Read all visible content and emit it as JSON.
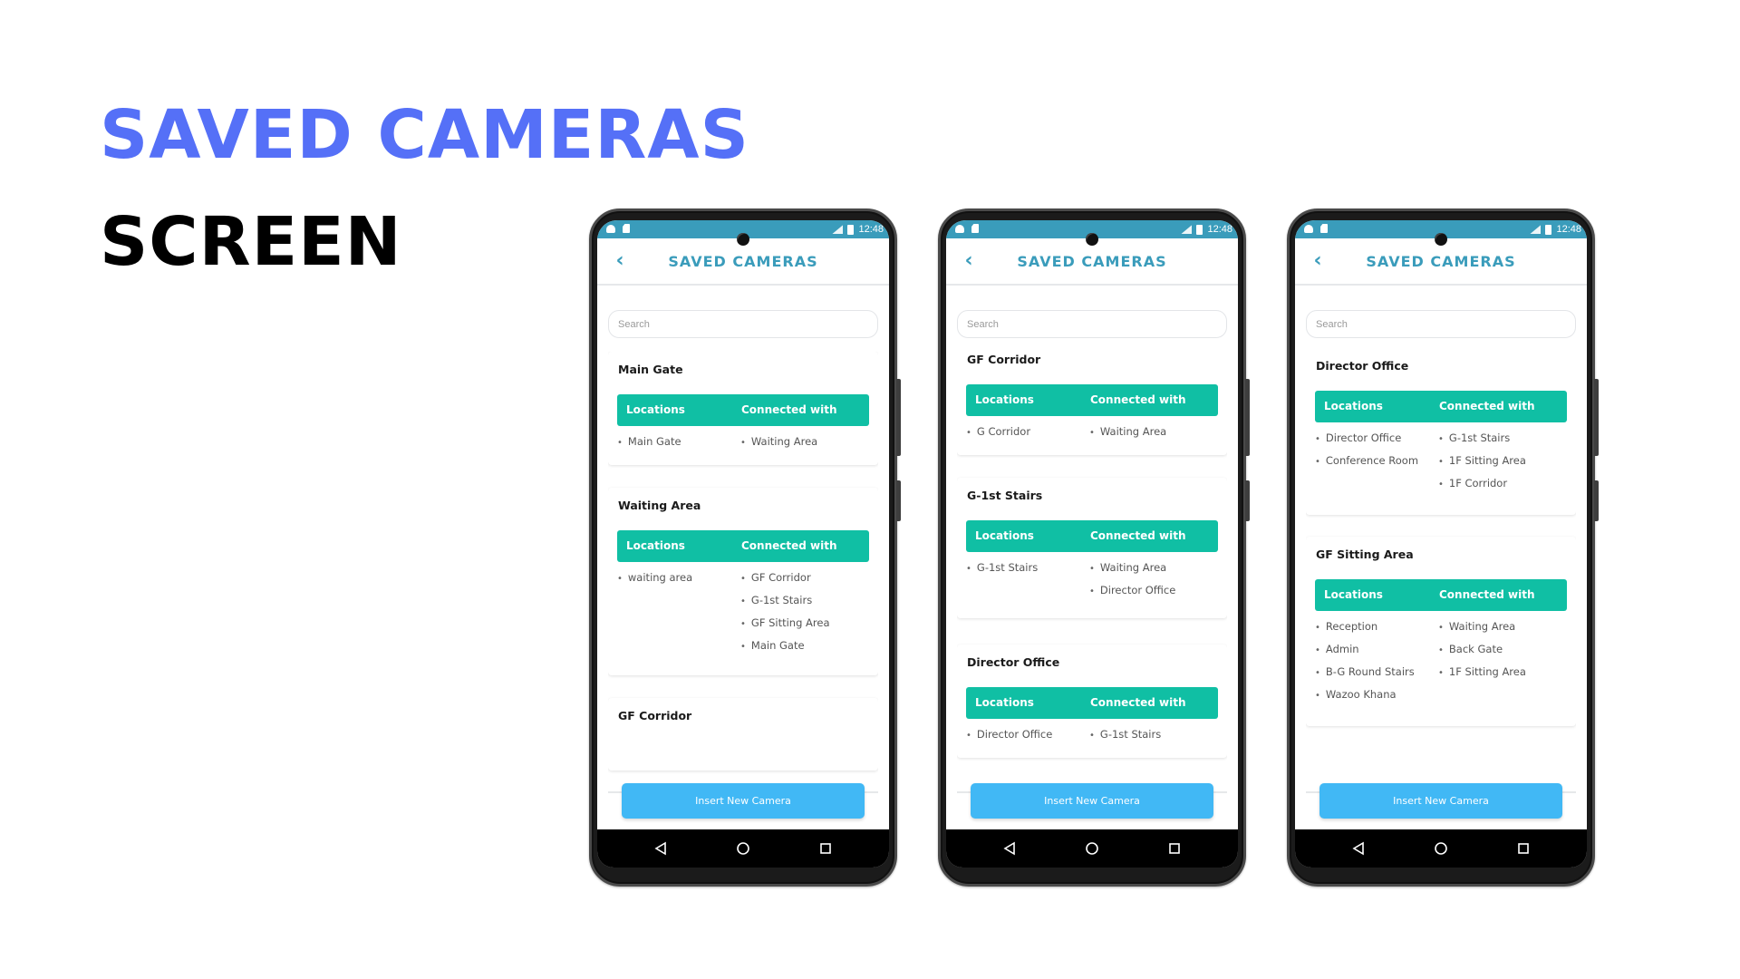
{
  "hero": {
    "title": "SAVED CAMERAS",
    "subtitle": "SCREEN",
    "title_color": "#5570f7",
    "subtitle_color": "#000000"
  },
  "theme": {
    "status_bar_color": "#3a9cbb",
    "header_text_color": "#3a9cbb",
    "table_header_color": "#10bfa4",
    "button_color": "#41b8f5"
  },
  "phones": [
    {
      "status_bar": {
        "time": "12:48"
      },
      "header": {
        "title": "SAVED CAMERAS",
        "back_icon": "chevron-left-icon"
      },
      "search": {
        "placeholder": "Search",
        "value": ""
      },
      "cards": [
        {
          "title": "Main Gate",
          "col_locations": "Locations",
          "col_connected": "Connected with",
          "locations": [
            "Main Gate"
          ],
          "connected": [
            "Waiting Area"
          ]
        },
        {
          "title": "Waiting Area",
          "col_locations": "Locations",
          "col_connected": "Connected with",
          "locations": [
            "waiting area"
          ],
          "connected": [
            "GF Corridor",
            "G-1st Stairs",
            "GF Sitting Area",
            "Main Gate"
          ]
        },
        {
          "title": "GF Corridor"
        }
      ],
      "insert_button": "Insert New Camera",
      "nav": [
        "back-triangle-icon",
        "home-circle-icon",
        "recents-square-icon"
      ]
    },
    {
      "status_bar": {
        "time": "12:48"
      },
      "header": {
        "title": "SAVED CAMERAS",
        "back_icon": "chevron-left-icon"
      },
      "search": {
        "placeholder": "Search",
        "value": ""
      },
      "cards": [
        {
          "title": "GF Corridor",
          "col_locations": "Locations",
          "col_connected": "Connected with",
          "locations": [
            "G Corridor"
          ],
          "connected": [
            "Waiting Area"
          ]
        },
        {
          "title": "G-1st Stairs",
          "col_locations": "Locations",
          "col_connected": "Connected with",
          "locations": [
            "G-1st Stairs"
          ],
          "connected": [
            "Waiting Area",
            "Director Office"
          ]
        },
        {
          "title": "Director Office",
          "col_locations": "Locations",
          "col_connected": "Connected with",
          "locations": [
            "Director Office"
          ],
          "connected": [
            "G-1st Stairs"
          ]
        }
      ],
      "insert_button": "Insert New Camera",
      "nav": [
        "back-triangle-icon",
        "home-circle-icon",
        "recents-square-icon"
      ]
    },
    {
      "status_bar": {
        "time": "12:48"
      },
      "header": {
        "title": "SAVED CAMERAS",
        "back_icon": "chevron-left-icon"
      },
      "search": {
        "placeholder": "Search",
        "value": ""
      },
      "cards": [
        {
          "title": "Director Office",
          "col_locations": "Locations",
          "col_connected": "Connected with",
          "locations": [
            "Director Office",
            "Conference Room"
          ],
          "connected": [
            "G-1st Stairs",
            "1F Sitting Area",
            "1F Corridor"
          ]
        },
        {
          "title": "GF Sitting Area",
          "col_locations": "Locations",
          "col_connected": "Connected with",
          "locations": [
            "Reception",
            "Admin",
            "B-G Round Stairs",
            "Wazoo Khana"
          ],
          "connected": [
            "Waiting Area",
            "Back Gate",
            "1F Sitting Area"
          ]
        }
      ],
      "insert_button": "Insert New Camera",
      "nav": [
        "back-triangle-icon",
        "home-circle-icon",
        "recents-square-icon"
      ]
    }
  ]
}
